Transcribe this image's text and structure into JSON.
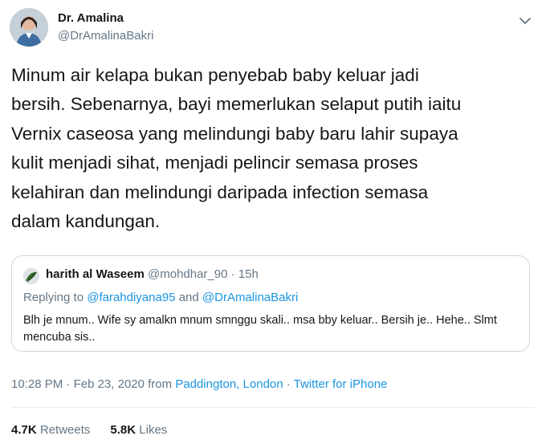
{
  "author": {
    "name": "Dr. Amalina",
    "handle": "@DrAmalinaBakri"
  },
  "tweet": {
    "text": "Minum air kelapa bukan penyebab baby keluar jadi\nbersih. Sebenarnya, bayi memerlukan selaput putih iaitu\nVernix caseosa yang melindungi baby baru lahir supaya\nkulit menjadi sihat, menjadi pelincir semasa proses\nkelahiran dan melindungi daripada infection semasa\ndalam kandungan."
  },
  "quoted": {
    "name": "harith al Waseem",
    "handle": "@mohdhar_90",
    "time": "15h",
    "replying_prefix": "Replying to",
    "replying_to_1": "@farahdiyana95",
    "replying_and": "and",
    "replying_to_2": "@DrAmalinaBakri",
    "text": "Blh je mnum.. Wife sy amalkn mnum smnggu skali.. msa bby keluar.. Bersih je.. Hehe.. Slmt mencuba sis.."
  },
  "meta": {
    "time": "10:28 PM",
    "date": "Feb 23, 2020",
    "from": "from",
    "location": "Paddington, London",
    "source": "Twitter for iPhone"
  },
  "stats": {
    "retweets_count": "4.7K",
    "retweets_label": "Retweets",
    "likes_count": "5.8K",
    "likes_label": "Likes"
  },
  "icons": {
    "caret": "chevron-down-icon"
  },
  "colors": {
    "link": "#1b95e0",
    "secondary_text": "#657786",
    "border": "#ccd6dd"
  }
}
